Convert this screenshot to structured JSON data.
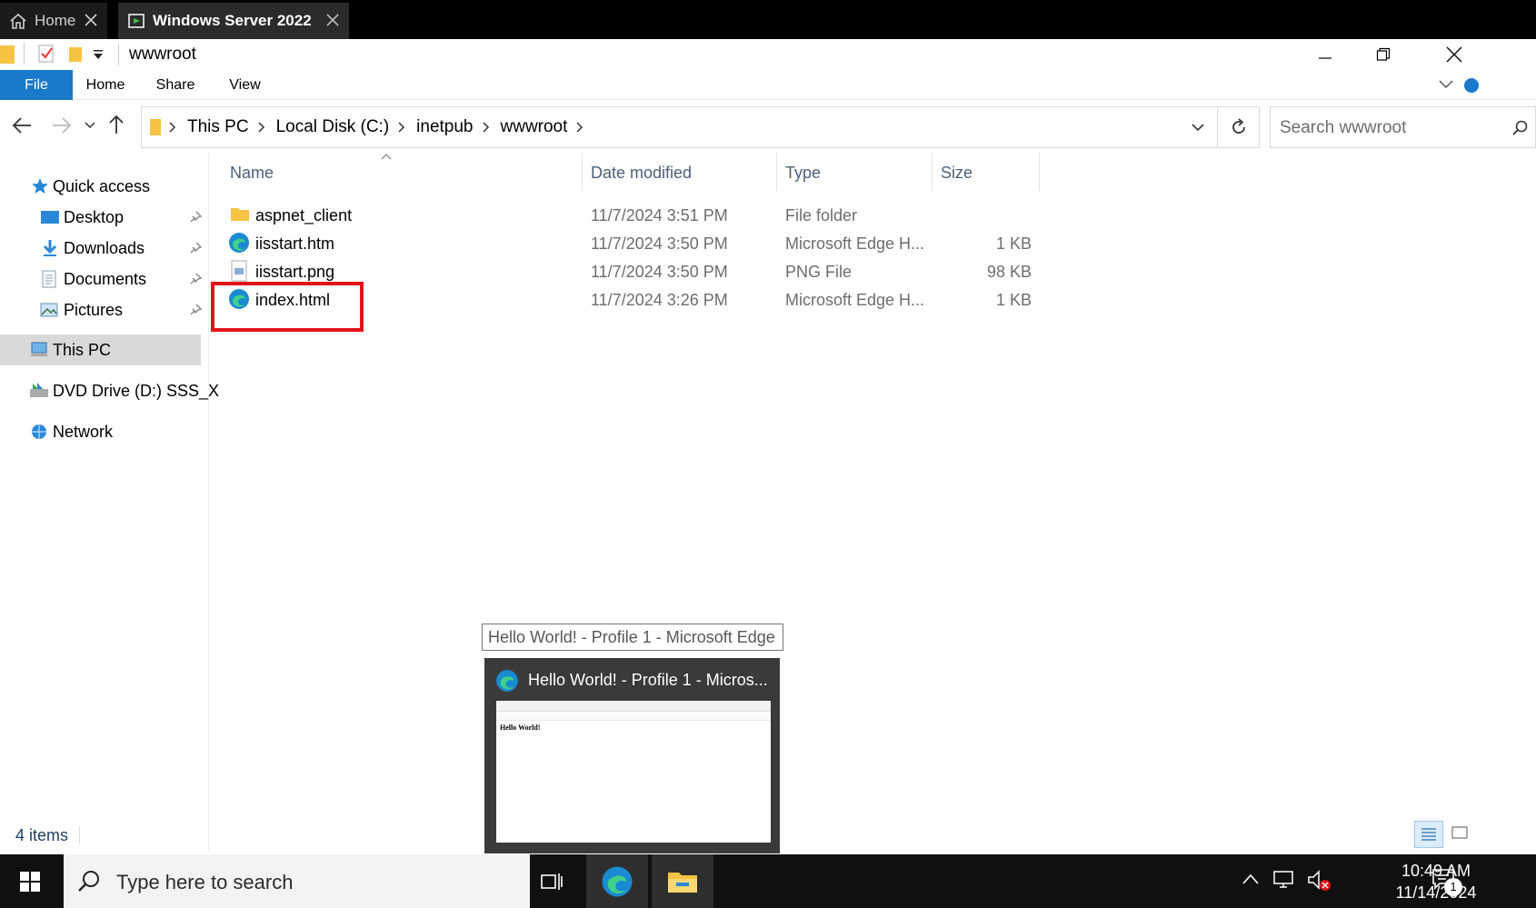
{
  "session_tabs": [
    {
      "label": "Home"
    },
    {
      "label": "Windows Server 2022"
    }
  ],
  "window": {
    "title": "wwwroot"
  },
  "ribbon": {
    "tabs": [
      "File",
      "Home",
      "Share",
      "View"
    ]
  },
  "address": {
    "crumbs": [
      "This PC",
      "Local Disk (C:)",
      "inetpub",
      "wwwroot"
    ],
    "search_placeholder": "Search wwwroot"
  },
  "nav": {
    "quick_access": "Quick access",
    "items": [
      "Desktop",
      "Downloads",
      "Documents",
      "Pictures"
    ],
    "this_pc": "This PC",
    "dvd": "DVD Drive (D:) SSS_X",
    "network": "Network"
  },
  "columns": {
    "name": "Name",
    "date": "Date modified",
    "type": "Type",
    "size": "Size"
  },
  "files": [
    {
      "name": "aspnet_client",
      "date": "11/7/2024 3:51 PM",
      "type": "File folder",
      "size": "",
      "icon": "folder-icon"
    },
    {
      "name": "iisstart.htm",
      "date": "11/7/2024 3:50 PM",
      "type": "Microsoft Edge H...",
      "size": "1 KB",
      "icon": "edge-icon"
    },
    {
      "name": "iisstart.png",
      "date": "11/7/2024 3:50 PM",
      "type": "PNG File",
      "size": "98 KB",
      "icon": "image-file-icon"
    },
    {
      "name": "index.html",
      "date": "11/7/2024 3:26 PM",
      "type": "Microsoft Edge H...",
      "size": "1 KB",
      "icon": "edge-icon"
    }
  ],
  "status": {
    "item_count": "4 items"
  },
  "tooltip": {
    "text": "Hello World! - Profile 1 - Microsoft Edge"
  },
  "thumbnail": {
    "title": "Hello World! - Profile 1 - Micros...",
    "page_text": "Hello World!"
  },
  "taskbar": {
    "search_placeholder": "Type here to search",
    "time": "10:49 AM",
    "date": "11/14/2024",
    "notification_count": "1"
  },
  "colors": {
    "accent": "#1979ca",
    "highlight": "#e3121a",
    "selected_nav": "#cce8ff"
  }
}
